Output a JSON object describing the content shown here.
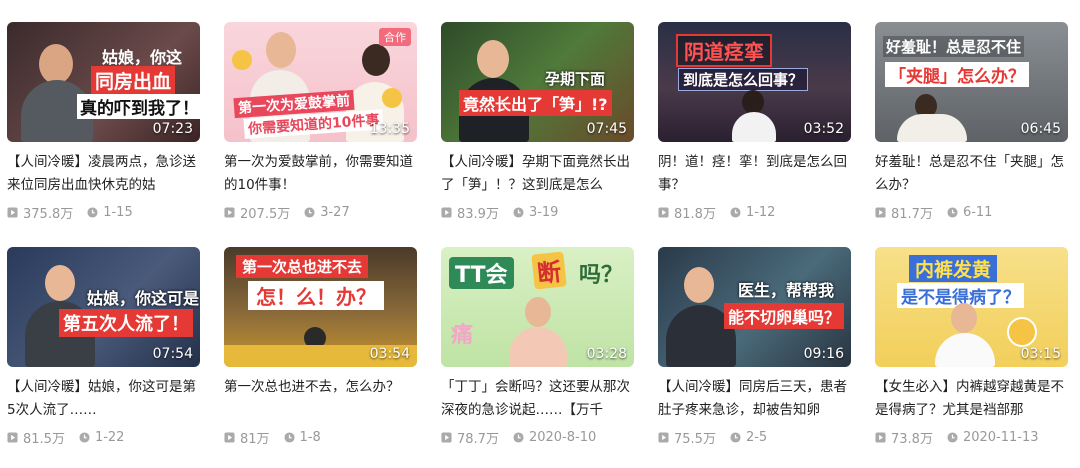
{
  "videos": [
    {
      "title": "【人间冷暖】凌晨两点，急诊送来位同房出血快休克的姑",
      "views": "375.8万",
      "date": "1-15",
      "duration": "07:23",
      "overlay": [
        "姑娘，你这",
        "同房出血",
        "真的吓到我了！"
      ]
    },
    {
      "title": "第一次为爱鼓掌前，你需要知道的10件事！",
      "views": "207.5万",
      "date": "3-27",
      "duration": "13:35",
      "badge": "合作",
      "overlay": [
        "第一次为爱鼓掌前",
        "你需要知道的10件事"
      ]
    },
    {
      "title": "【人间冷暖】孕期下面竟然长出了「笋」！？这到底是怎么",
      "views": "83.9万",
      "date": "3-19",
      "duration": "07:45",
      "overlay": [
        "孕期下面",
        "竟然长出了「笋」!?"
      ]
    },
    {
      "title": "阴！道！痉！挛！到底是怎么回事？",
      "views": "81.8万",
      "date": "1-12",
      "duration": "03:52",
      "overlay": [
        "阴道痉挛",
        "到底是怎么回事？"
      ]
    },
    {
      "title": "好羞耻！总是忍不住「夹腿」怎么办？",
      "views": "81.7万",
      "date": "6-11",
      "duration": "06:45",
      "overlay": [
        "好羞耻！总是忍不住",
        "「夹腿」怎么办？"
      ]
    },
    {
      "title": "【人间冷暖】姑娘，你这可是第5次人流了……",
      "views": "81.5万",
      "date": "1-22",
      "duration": "07:54",
      "overlay": [
        "姑娘，你这可是",
        "第五次人流了！"
      ]
    },
    {
      "title": "第一次总也进不去，怎么办？",
      "views": "81万",
      "date": "1-8",
      "duration": "03:54",
      "overlay": [
        "第一次总也进不去",
        "怎！么！办？"
      ]
    },
    {
      "title": "「丁丁」会断吗？这还要从那次深夜的急诊说起……【万千",
      "views": "78.7万",
      "date": "2020-8-10",
      "duration": "03:28",
      "overlay": [
        "TT会",
        "断",
        "吗？",
        "痛"
      ]
    },
    {
      "title": "【人间冷暖】同房后三天，患者肚子疼来急诊，却被告知卵",
      "views": "75.5万",
      "date": "2-5",
      "duration": "09:16",
      "overlay": [
        "医生，帮帮我",
        "能不切卵巢吗？"
      ]
    },
    {
      "title": "【女生必入】内裤越穿越黄是不是得病了？尤其是裆部那",
      "views": "73.8万",
      "date": "2020-11-13",
      "duration": "03:15",
      "overlay": [
        "内裤发黄",
        "是不是得病了？"
      ]
    }
  ],
  "icons": {
    "views": "play-count-icon",
    "date": "clock-icon"
  }
}
